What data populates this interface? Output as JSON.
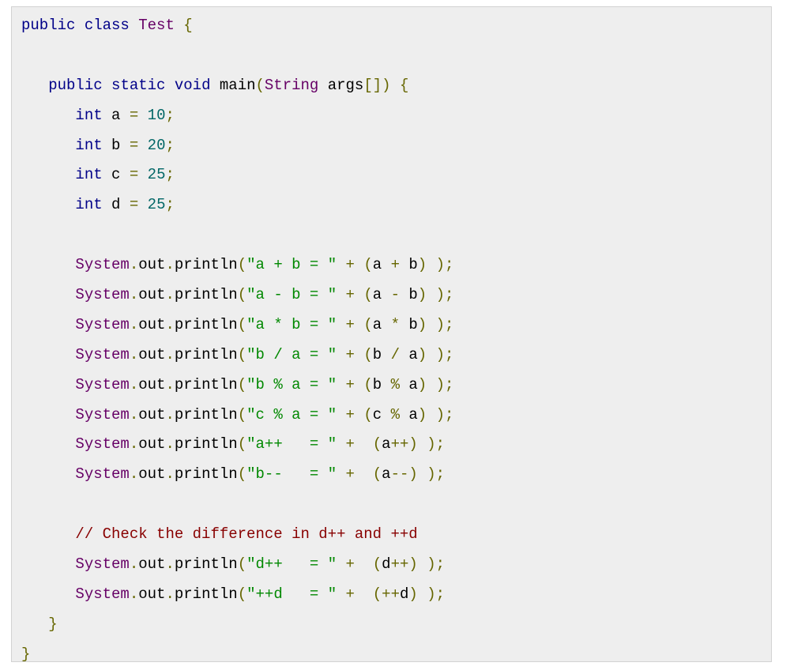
{
  "colors": {
    "keyword": "#000088",
    "type": "#660066",
    "plain": "#000000",
    "punctuation": "#666600",
    "literal": "#006666",
    "string": "#008800",
    "comment": "#880000",
    "background": "#eeeeee",
    "border": "#d2d2d2"
  },
  "code": {
    "language": "java",
    "lines": [
      [
        [
          "kwd",
          "public"
        ],
        [
          "pln",
          " "
        ],
        [
          "kwd",
          "class"
        ],
        [
          "pln",
          " "
        ],
        [
          "typ",
          "Test"
        ],
        [
          "pln",
          " "
        ],
        [
          "pun",
          "{"
        ]
      ],
      [],
      [
        [
          "pln",
          "   "
        ],
        [
          "kwd",
          "public"
        ],
        [
          "pln",
          " "
        ],
        [
          "kwd",
          "static"
        ],
        [
          "pln",
          " "
        ],
        [
          "kwd",
          "void"
        ],
        [
          "pln",
          " main"
        ],
        [
          "pun",
          "("
        ],
        [
          "typ",
          "String"
        ],
        [
          "pln",
          " args"
        ],
        [
          "pun",
          "[])"
        ],
        [
          "pln",
          " "
        ],
        [
          "pun",
          "{"
        ]
      ],
      [
        [
          "pln",
          "      "
        ],
        [
          "kwd",
          "int"
        ],
        [
          "pln",
          " a "
        ],
        [
          "pun",
          "="
        ],
        [
          "pln",
          " "
        ],
        [
          "lit",
          "10"
        ],
        [
          "pun",
          ";"
        ]
      ],
      [
        [
          "pln",
          "      "
        ],
        [
          "kwd",
          "int"
        ],
        [
          "pln",
          " b "
        ],
        [
          "pun",
          "="
        ],
        [
          "pln",
          " "
        ],
        [
          "lit",
          "20"
        ],
        [
          "pun",
          ";"
        ]
      ],
      [
        [
          "pln",
          "      "
        ],
        [
          "kwd",
          "int"
        ],
        [
          "pln",
          " c "
        ],
        [
          "pun",
          "="
        ],
        [
          "pln",
          " "
        ],
        [
          "lit",
          "25"
        ],
        [
          "pun",
          ";"
        ]
      ],
      [
        [
          "pln",
          "      "
        ],
        [
          "kwd",
          "int"
        ],
        [
          "pln",
          " d "
        ],
        [
          "pun",
          "="
        ],
        [
          "pln",
          " "
        ],
        [
          "lit",
          "25"
        ],
        [
          "pun",
          ";"
        ]
      ],
      [],
      [
        [
          "pln",
          "      "
        ],
        [
          "typ",
          "System"
        ],
        [
          "pun",
          "."
        ],
        [
          "pln",
          "out"
        ],
        [
          "pun",
          "."
        ],
        [
          "pln",
          "println"
        ],
        [
          "pun",
          "("
        ],
        [
          "str",
          "\"a + b = \""
        ],
        [
          "pln",
          " "
        ],
        [
          "pun",
          "+"
        ],
        [
          "pln",
          " "
        ],
        [
          "pun",
          "("
        ],
        [
          "pln",
          "a "
        ],
        [
          "pun",
          "+"
        ],
        [
          "pln",
          " b"
        ],
        [
          "pun",
          ")"
        ],
        [
          "pln",
          " "
        ],
        [
          "pun",
          ");"
        ]
      ],
      [
        [
          "pln",
          "      "
        ],
        [
          "typ",
          "System"
        ],
        [
          "pun",
          "."
        ],
        [
          "pln",
          "out"
        ],
        [
          "pun",
          "."
        ],
        [
          "pln",
          "println"
        ],
        [
          "pun",
          "("
        ],
        [
          "str",
          "\"a - b = \""
        ],
        [
          "pln",
          " "
        ],
        [
          "pun",
          "+"
        ],
        [
          "pln",
          " "
        ],
        [
          "pun",
          "("
        ],
        [
          "pln",
          "a "
        ],
        [
          "pun",
          "-"
        ],
        [
          "pln",
          " b"
        ],
        [
          "pun",
          ")"
        ],
        [
          "pln",
          " "
        ],
        [
          "pun",
          ");"
        ]
      ],
      [
        [
          "pln",
          "      "
        ],
        [
          "typ",
          "System"
        ],
        [
          "pun",
          "."
        ],
        [
          "pln",
          "out"
        ],
        [
          "pun",
          "."
        ],
        [
          "pln",
          "println"
        ],
        [
          "pun",
          "("
        ],
        [
          "str",
          "\"a * b = \""
        ],
        [
          "pln",
          " "
        ],
        [
          "pun",
          "+"
        ],
        [
          "pln",
          " "
        ],
        [
          "pun",
          "("
        ],
        [
          "pln",
          "a "
        ],
        [
          "pun",
          "*"
        ],
        [
          "pln",
          " b"
        ],
        [
          "pun",
          ")"
        ],
        [
          "pln",
          " "
        ],
        [
          "pun",
          ");"
        ]
      ],
      [
        [
          "pln",
          "      "
        ],
        [
          "typ",
          "System"
        ],
        [
          "pun",
          "."
        ],
        [
          "pln",
          "out"
        ],
        [
          "pun",
          "."
        ],
        [
          "pln",
          "println"
        ],
        [
          "pun",
          "("
        ],
        [
          "str",
          "\"b / a = \""
        ],
        [
          "pln",
          " "
        ],
        [
          "pun",
          "+"
        ],
        [
          "pln",
          " "
        ],
        [
          "pun",
          "("
        ],
        [
          "pln",
          "b "
        ],
        [
          "pun",
          "/"
        ],
        [
          "pln",
          " a"
        ],
        [
          "pun",
          ")"
        ],
        [
          "pln",
          " "
        ],
        [
          "pun",
          ");"
        ]
      ],
      [
        [
          "pln",
          "      "
        ],
        [
          "typ",
          "System"
        ],
        [
          "pun",
          "."
        ],
        [
          "pln",
          "out"
        ],
        [
          "pun",
          "."
        ],
        [
          "pln",
          "println"
        ],
        [
          "pun",
          "("
        ],
        [
          "str",
          "\"b % a = \""
        ],
        [
          "pln",
          " "
        ],
        [
          "pun",
          "+"
        ],
        [
          "pln",
          " "
        ],
        [
          "pun",
          "("
        ],
        [
          "pln",
          "b "
        ],
        [
          "pun",
          "%"
        ],
        [
          "pln",
          " a"
        ],
        [
          "pun",
          ")"
        ],
        [
          "pln",
          " "
        ],
        [
          "pun",
          ");"
        ]
      ],
      [
        [
          "pln",
          "      "
        ],
        [
          "typ",
          "System"
        ],
        [
          "pun",
          "."
        ],
        [
          "pln",
          "out"
        ],
        [
          "pun",
          "."
        ],
        [
          "pln",
          "println"
        ],
        [
          "pun",
          "("
        ],
        [
          "str",
          "\"c % a = \""
        ],
        [
          "pln",
          " "
        ],
        [
          "pun",
          "+"
        ],
        [
          "pln",
          " "
        ],
        [
          "pun",
          "("
        ],
        [
          "pln",
          "c "
        ],
        [
          "pun",
          "%"
        ],
        [
          "pln",
          " a"
        ],
        [
          "pun",
          ")"
        ],
        [
          "pln",
          " "
        ],
        [
          "pun",
          ");"
        ]
      ],
      [
        [
          "pln",
          "      "
        ],
        [
          "typ",
          "System"
        ],
        [
          "pun",
          "."
        ],
        [
          "pln",
          "out"
        ],
        [
          "pun",
          "."
        ],
        [
          "pln",
          "println"
        ],
        [
          "pun",
          "("
        ],
        [
          "str",
          "\"a++   = \""
        ],
        [
          "pln",
          " "
        ],
        [
          "pun",
          "+"
        ],
        [
          "pln",
          "  "
        ],
        [
          "pun",
          "("
        ],
        [
          "pln",
          "a"
        ],
        [
          "pun",
          "++)"
        ],
        [
          "pln",
          " "
        ],
        [
          "pun",
          ");"
        ]
      ],
      [
        [
          "pln",
          "      "
        ],
        [
          "typ",
          "System"
        ],
        [
          "pun",
          "."
        ],
        [
          "pln",
          "out"
        ],
        [
          "pun",
          "."
        ],
        [
          "pln",
          "println"
        ],
        [
          "pun",
          "("
        ],
        [
          "str",
          "\"b--   = \""
        ],
        [
          "pln",
          " "
        ],
        [
          "pun",
          "+"
        ],
        [
          "pln",
          "  "
        ],
        [
          "pun",
          "("
        ],
        [
          "pln",
          "a"
        ],
        [
          "pun",
          "--)"
        ],
        [
          "pln",
          " "
        ],
        [
          "pun",
          ");"
        ]
      ],
      [],
      [
        [
          "pln",
          "      "
        ],
        [
          "com",
          "// Check the difference in d++ and ++d"
        ]
      ],
      [
        [
          "pln",
          "      "
        ],
        [
          "typ",
          "System"
        ],
        [
          "pun",
          "."
        ],
        [
          "pln",
          "out"
        ],
        [
          "pun",
          "."
        ],
        [
          "pln",
          "println"
        ],
        [
          "pun",
          "("
        ],
        [
          "str",
          "\"d++   = \""
        ],
        [
          "pln",
          " "
        ],
        [
          "pun",
          "+"
        ],
        [
          "pln",
          "  "
        ],
        [
          "pun",
          "("
        ],
        [
          "pln",
          "d"
        ],
        [
          "pun",
          "++)"
        ],
        [
          "pln",
          " "
        ],
        [
          "pun",
          ");"
        ]
      ],
      [
        [
          "pln",
          "      "
        ],
        [
          "typ",
          "System"
        ],
        [
          "pun",
          "."
        ],
        [
          "pln",
          "out"
        ],
        [
          "pun",
          "."
        ],
        [
          "pln",
          "println"
        ],
        [
          "pun",
          "("
        ],
        [
          "str",
          "\"++d   = \""
        ],
        [
          "pln",
          " "
        ],
        [
          "pun",
          "+"
        ],
        [
          "pln",
          "  "
        ],
        [
          "pun",
          "(++"
        ],
        [
          "pln",
          "d"
        ],
        [
          "pun",
          ")"
        ],
        [
          "pln",
          " "
        ],
        [
          "pun",
          ");"
        ]
      ],
      [
        [
          "pln",
          "   "
        ],
        [
          "pun",
          "}"
        ]
      ],
      [
        [
          "pun",
          "}"
        ]
      ]
    ]
  }
}
